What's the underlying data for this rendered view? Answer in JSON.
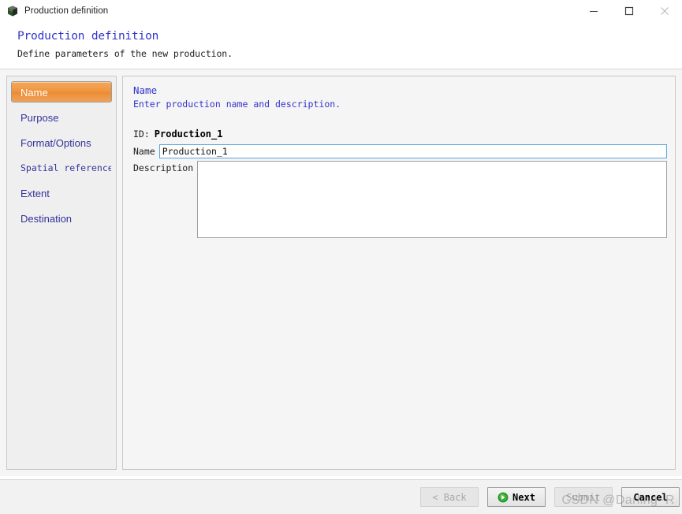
{
  "window": {
    "title": "Production definition",
    "icon": "cube-icon",
    "controls": {
      "minimize": "minimize-icon",
      "maximize": "maximize-icon",
      "close": "close-icon"
    }
  },
  "header": {
    "title": "Production definition",
    "subtitle": "Define parameters of the new production."
  },
  "sidebar": {
    "items": [
      {
        "label": "Name",
        "active": true,
        "mono": false
      },
      {
        "label": "Purpose",
        "active": false,
        "mono": false
      },
      {
        "label": "Format/Options",
        "active": false,
        "mono": false
      },
      {
        "label": "Spatial reference s",
        "active": false,
        "mono": true
      },
      {
        "label": "Extent",
        "active": false,
        "mono": false
      },
      {
        "label": "Destination",
        "active": false,
        "mono": false
      }
    ]
  },
  "main": {
    "section_title": "Name",
    "section_subtitle": "Enter production name and description.",
    "id_label": "ID:",
    "id_value": "Production_1",
    "name_label": "Name",
    "name_value": "Production_1",
    "name_placeholder": "",
    "description_label": "Description",
    "description_value": "",
    "description_placeholder": ""
  },
  "footer": {
    "back_label": "< Back",
    "next_label": "Next",
    "next_icon": "green-arrow-right-icon",
    "submit_label": "Submit",
    "cancel_label": "Cancel"
  },
  "watermark": {
    "text": "CSDN @Darling~R"
  },
  "colors": {
    "accent_orange": "#ef9440",
    "link_blue": "#3333cc",
    "focus_blue": "#5aa5e0",
    "next_green": "#2aa02a"
  }
}
